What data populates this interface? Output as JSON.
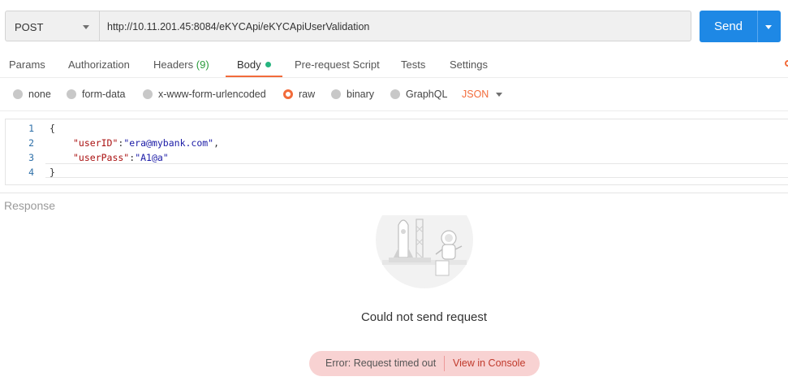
{
  "request": {
    "method": "POST",
    "url": "http://10.11.201.45:8084/eKYCApi/eKYCApiUserValidation",
    "send_label": "Send"
  },
  "tabs": [
    {
      "label": "Params"
    },
    {
      "label": "Authorization"
    },
    {
      "label": "Headers",
      "count": "(9)"
    },
    {
      "label": "Body",
      "active": true
    },
    {
      "label": "Pre-request Script"
    },
    {
      "label": "Tests"
    },
    {
      "label": "Settings"
    }
  ],
  "body_types": [
    {
      "label": "none"
    },
    {
      "label": "form-data"
    },
    {
      "label": "x-www-form-urlencoded"
    },
    {
      "label": "raw",
      "selected": true
    },
    {
      "label": "binary"
    },
    {
      "label": "GraphQL"
    }
  ],
  "format": "JSON",
  "editor": {
    "line_numbers": [
      "1",
      "2",
      "3",
      "4"
    ],
    "line1": "{",
    "line2_key": "\"userID\"",
    "line2_colon": ":",
    "line2_val": "\"era@mybank.com\"",
    "line2_comma": ",",
    "line3_key": "\"userPass\"",
    "line3_colon": ":",
    "line3_val": "\"A1@a\"",
    "line4": "}"
  },
  "response": {
    "label": "Response",
    "message": "Could not send request",
    "error": "Error: Request timed out",
    "view_console": "View in Console"
  },
  "colors": {
    "accent": "#f26b3a",
    "send": "#1e88e5",
    "error_bg": "#f8d2d2"
  }
}
